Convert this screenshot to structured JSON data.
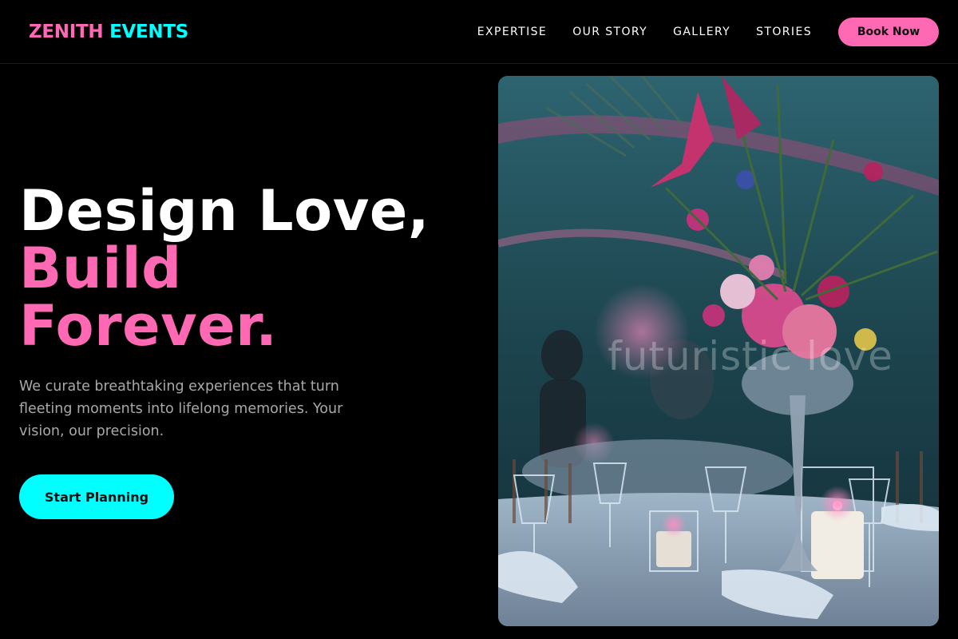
{
  "brand": {
    "part1": "ZENITH",
    "part2": "EVENTS",
    "color1": "#ff69b4",
    "color2": "#00ffff"
  },
  "nav": {
    "links": [
      "EXPERTISE",
      "OUR STORY",
      "GALLERY",
      "STORIES"
    ],
    "cta": "Book Now"
  },
  "hero": {
    "title_line1": "Design Love,",
    "title_line2": "Build",
    "title_line3": "Forever.",
    "description": "We curate breathtaking experiences that turn fleeting moments into lifelong memories. Your vision, our precision.",
    "cta": "Start Planning",
    "image_watermark": "futuristic love",
    "image_icon": "event-table-photo"
  },
  "colors": {
    "pink": "#ff69b4",
    "cyan": "#00ffff",
    "background": "#000000"
  }
}
